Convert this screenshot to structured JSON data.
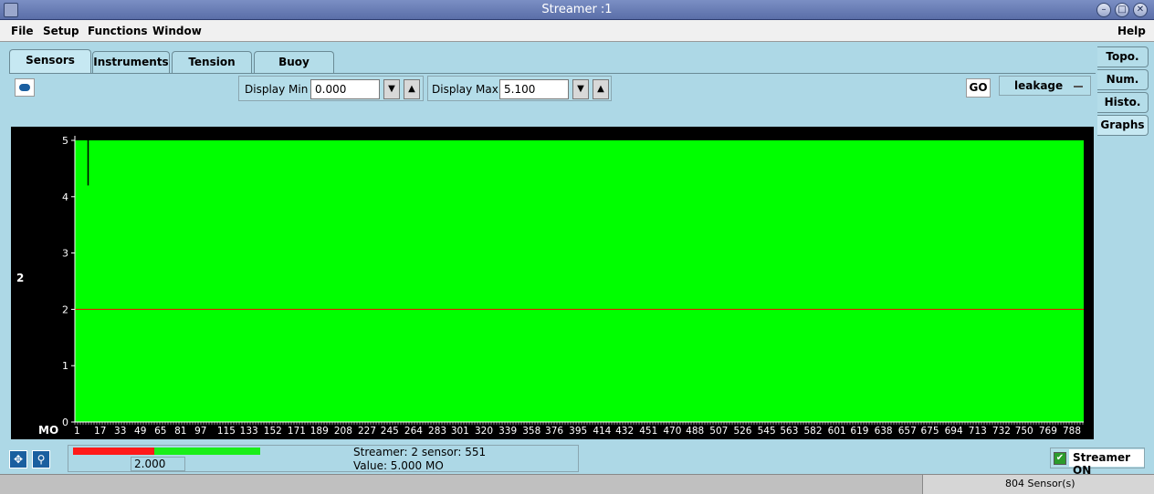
{
  "window": {
    "title": "Streamer :1"
  },
  "menubar": {
    "items": [
      {
        "label": "File"
      },
      {
        "label": "Setup"
      },
      {
        "label": "Functions"
      },
      {
        "label": "Window"
      }
    ],
    "help": "Help"
  },
  "tabs": [
    {
      "label": "Sensors",
      "active": true
    },
    {
      "label": "Instruments",
      "active": false
    },
    {
      "label": "Tension",
      "active": false
    },
    {
      "label": "Buoy Current",
      "active": false
    }
  ],
  "side_tabs": [
    {
      "label": "Topo.",
      "active": false
    },
    {
      "label": "Num.",
      "active": false
    },
    {
      "label": "Histo.",
      "active": false
    },
    {
      "label": "Graphs",
      "active": true
    }
  ],
  "controls": {
    "display_min_label": "Display Min",
    "display_min_value": "0.000",
    "display_max_label": "Display Max",
    "display_max_value": "5.100",
    "go_label": "GO",
    "mode_selected": "leakage"
  },
  "chart_data": {
    "type": "bar",
    "title": "",
    "series_label": "2",
    "ylabel": "MO",
    "ylim": [
      0,
      5
    ],
    "yticks": [
      "0",
      "1",
      "2",
      "3",
      "4",
      "5"
    ],
    "xticks": [
      "1",
      "17",
      "33",
      "49",
      "65",
      "81",
      "97",
      "115",
      "133",
      "152",
      "171",
      "189",
      "208",
      "227",
      "245",
      "264",
      "283",
      "301",
      "320",
      "339",
      "358",
      "376",
      "395",
      "414",
      "432",
      "451",
      "470",
      "488",
      "507",
      "526",
      "545",
      "563",
      "582",
      "601",
      "619",
      "638",
      "657",
      "675",
      "694",
      "713",
      "732",
      "750",
      "769",
      "788"
    ],
    "sensor_count": 804,
    "fill_value": 5.0,
    "fill_color": "#00ff00",
    "threshold": 2.0,
    "threshold_color": "#ff0000",
    "dip": {
      "sensor": 4,
      "value": 4.2
    }
  },
  "bottom": {
    "input_value": "2.000",
    "streamer_text": "Streamer: 2  sensor: 551",
    "value_text": "Value:  5.000 MO",
    "streamer_on_label": "Streamer ON",
    "sensors_text": "804 Sensor(s)"
  }
}
